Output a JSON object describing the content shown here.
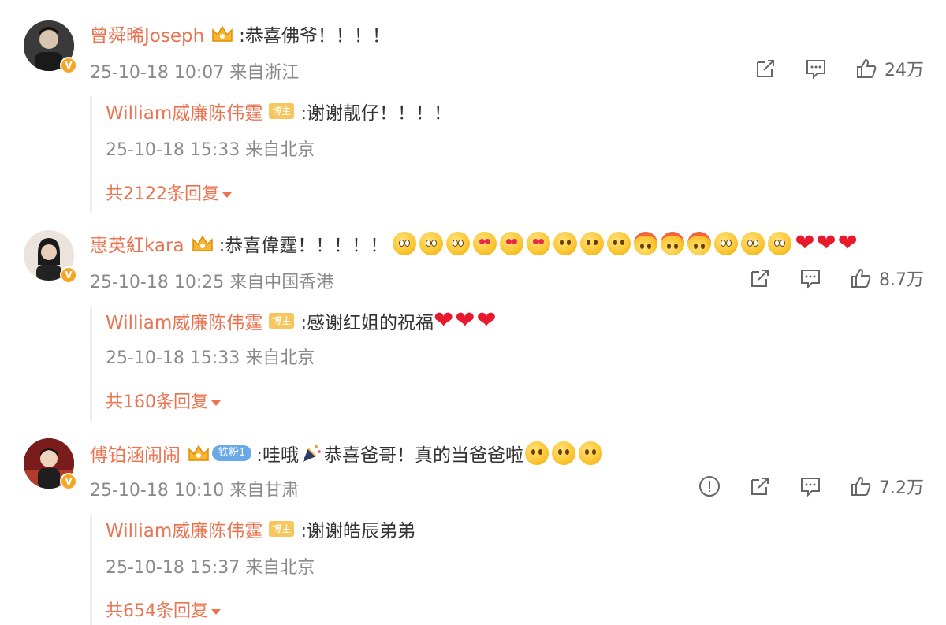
{
  "comments": [
    {
      "username": "曾舜晞Joseph",
      "text": ":恭喜佛爷！！！！",
      "date": "25-10-18 10:07",
      "location": "来自浙江",
      "likes": "24万",
      "reply": {
        "username": "William威廉陈伟霆",
        "badge": "博主",
        "text": ":谢谢靓仔！！！！",
        "date": "25-10-18 15:33",
        "location": "来自北京"
      },
      "more_replies": "共2122条回复"
    },
    {
      "username": "惠英紅kara",
      "text": ":恭喜偉霆！！！！！",
      "date": "25-10-18 10:25",
      "location": "来自中国香港",
      "likes": "8.7万",
      "reply": {
        "username": "William威廉陈伟霆",
        "badge": "博主",
        "text": ":感谢红姐的祝福",
        "date": "25-10-18 15:33",
        "location": "来自北京"
      },
      "more_replies": "共160条回复"
    },
    {
      "username": "傅铂涵闹闹",
      "fan_badge": "铁粉1",
      "text_a": ":哇哦",
      "text_b": "恭喜爸哥！真的当爸爸啦",
      "date": "25-10-18 10:10",
      "location": "来自甘肃",
      "likes": "7.2万",
      "reply": {
        "username": "William威廉陈伟霆",
        "badge": "博主",
        "text": ":谢谢皓辰弟弟",
        "date": "25-10-18 15:37",
        "location": "来自北京"
      },
      "more_replies": "共654条回复"
    }
  ],
  "icons": {
    "verified": "verified-v-badge-icon",
    "vip": "crown-icon",
    "share": "share-icon",
    "comment": "comment-icon",
    "like": "thumbs-up-icon",
    "report": "report-icon",
    "expand": "caret-down-icon"
  },
  "colors": {
    "username": "#eb7350",
    "meta": "#8a8a8a",
    "badge": "#f7c65c",
    "verified": "#f5a623",
    "heart": "#e8192c"
  }
}
